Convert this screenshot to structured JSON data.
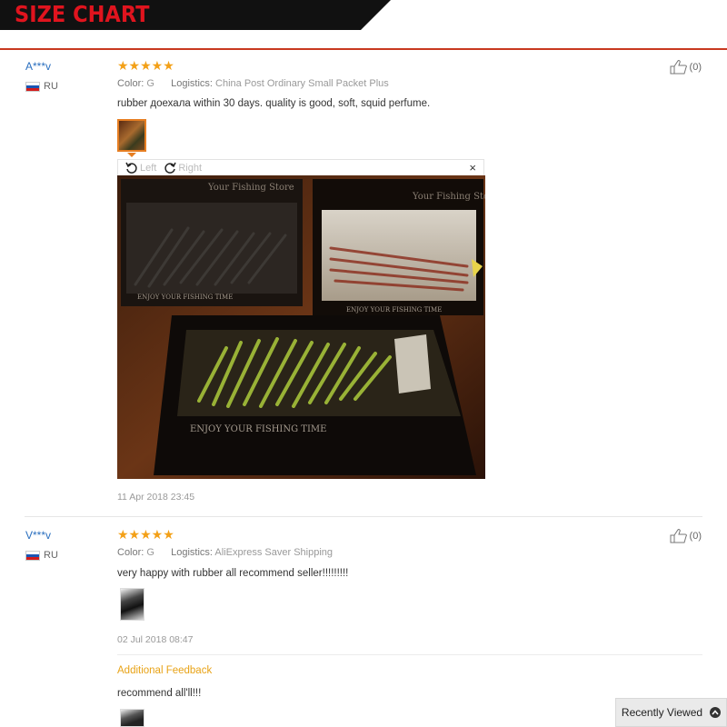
{
  "banner": {
    "title": "SIZE CHART"
  },
  "reviews": [
    {
      "user": "A***v",
      "country": "RU",
      "rating": "★★★★★",
      "color_label": "Color:",
      "color_value": "G",
      "logistics_label": "Logistics:",
      "logistics_value": "China Post Ordinary Small Packet Plus",
      "text": "rubber доехала within 30 days. quality is good, soft, squid perfume.",
      "helpful_count": "(0)",
      "date": "11 Apr 2018 23:45",
      "viewer": {
        "rotate_left": "Left",
        "rotate_right": "Right",
        "close": "×"
      }
    },
    {
      "user": "V***v",
      "country": "RU",
      "rating": "★★★★★",
      "color_label": "Color:",
      "color_value": "G",
      "logistics_label": "Logistics:",
      "logistics_value": "AliExpress Saver Shipping",
      "text": "very happy with rubber all recommend seller!!!!!!!!!",
      "helpful_count": "(0)",
      "date": "02 Jul 2018 08:47",
      "additional_feedback_label": "Additional Feedback",
      "additional_feedback_text": "recommend all'll!!!"
    }
  ],
  "photo_watermarks": [
    "Your Fishing Store",
    "Your Fishing Sto",
    "ENJOY YOUR FISHING TIME",
    "ENJOY YOUR FISHING TIME",
    "ENJOY YOUR FISHING TIME"
  ],
  "recently_viewed": {
    "label": "Recently Viewed"
  },
  "colors": {
    "brand_red": "#e0141e",
    "star": "#f3a017",
    "link_blue": "#2a6fbf",
    "accent_orange": "#e8a317"
  }
}
